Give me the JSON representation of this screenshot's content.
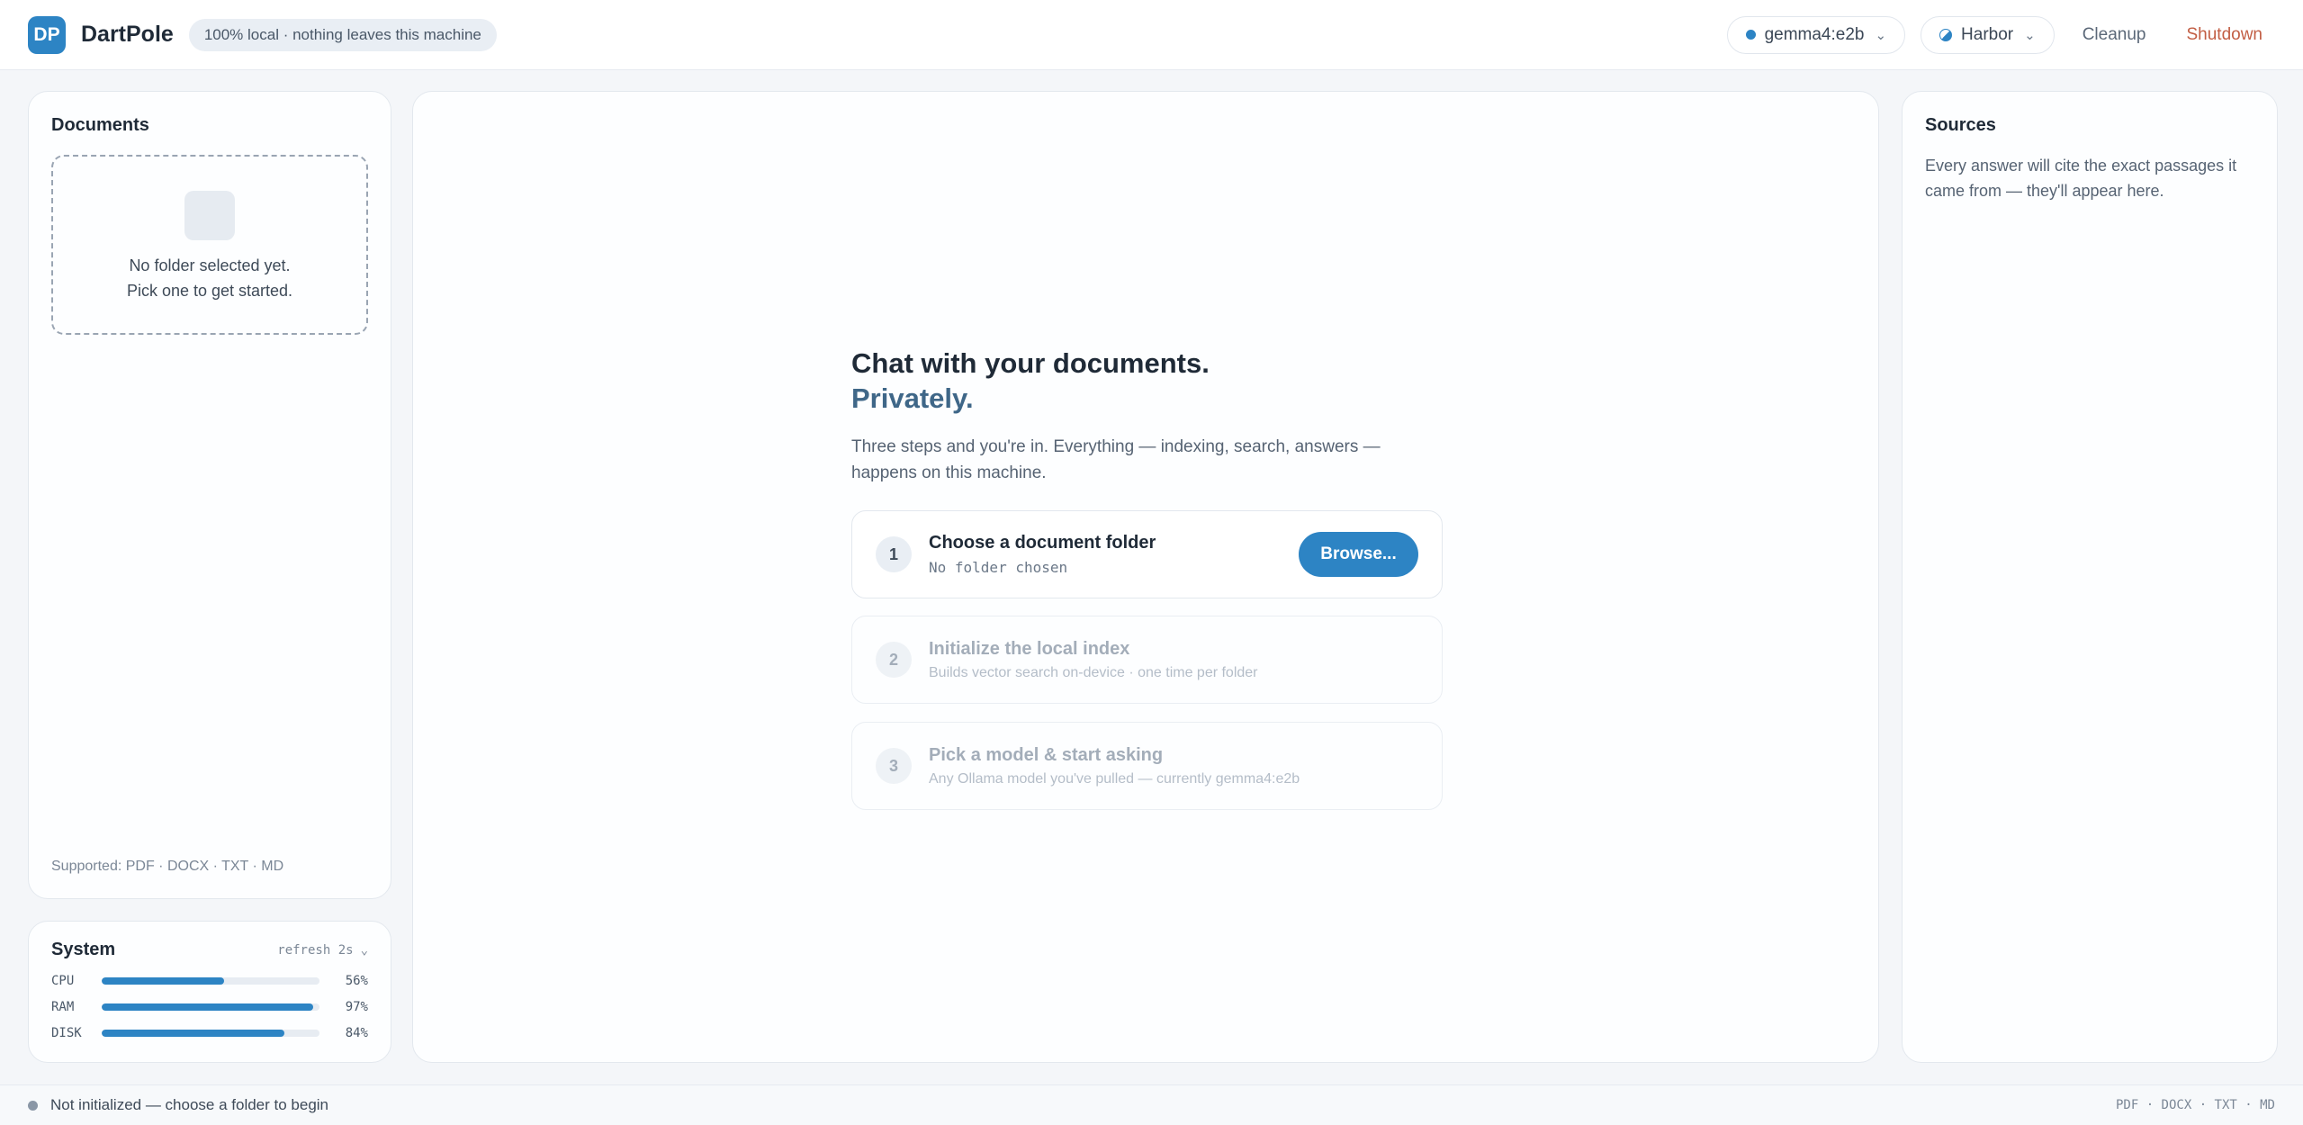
{
  "header": {
    "logo": "DP",
    "app_name": "DartPole",
    "privacy_badge": "100% local · nothing leaves this machine",
    "model_label": "gemma4:e2b",
    "theme_label": "Harbor",
    "cleanup_label": "Cleanup",
    "shutdown_label": "Shutdown"
  },
  "documents": {
    "title": "Documents",
    "empty_line1": "No folder selected yet.",
    "empty_line2": "Pick one to get started.",
    "supported": "Supported: PDF · DOCX · TXT · MD"
  },
  "system": {
    "title": "System",
    "refresh_label": "refresh 2s",
    "metrics": [
      {
        "name": "CPU",
        "value_label": "56%",
        "fraction": 0.56
      },
      {
        "name": "RAM",
        "value_label": "97%",
        "fraction": 0.97
      },
      {
        "name": "DISK",
        "value_label": "84%",
        "fraction": 0.84
      }
    ]
  },
  "chat": {
    "heading_line1": "Chat with your documents.",
    "heading_line2": "Privately.",
    "intro_line1": "Three steps and you're in. Everything — indexing, search, answers —",
    "intro_line2": "happens on this machine.",
    "steps": [
      {
        "num": "1",
        "title": "Choose a document folder",
        "sub": "No folder chosen",
        "button": "Browse..."
      },
      {
        "num": "2",
        "title": "Initialize the local index",
        "sub": "Builds vector search on-device · one time per folder"
      },
      {
        "num": "3",
        "title": "Pick a model & start asking",
        "sub": "Any Ollama model you've pulled — currently gemma4:e2b"
      }
    ]
  },
  "sources": {
    "title": "Sources",
    "desc_line1": "Every answer will cite the exact passages it",
    "desc_line2": "came from — they'll appear here."
  },
  "statusbar": {
    "status_text": "Not initialized — choose a folder to begin",
    "formats": "PDF · DOCX · TXT · MD"
  },
  "colors": {
    "accent": "#2d84c4",
    "danger": "#c25e44",
    "heading_accent": "#3f6788"
  }
}
